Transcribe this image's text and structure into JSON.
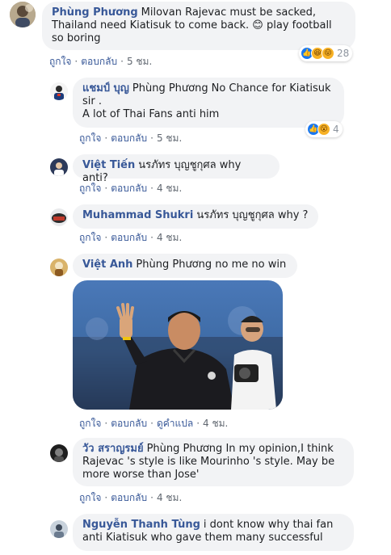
{
  "actions": {
    "like": "ถูกใจ",
    "reply": "ตอบกลับ",
    "see_translation": "ดูคำแปล"
  },
  "comments": [
    {
      "name": "Phùng Phương",
      "text": "Milovan Rajevac must be sacked, Thailand need Kiatisuk to come back. 😊 play football so boring",
      "time": "5 ชม.",
      "reaction_count": "28"
    },
    {
      "name": "แชมป์ บุญ",
      "tag": "Phùng Phương",
      "text_line1": "No Chance for Kiatisuk sir .",
      "text_line2": "A lot of Thai Fans anti him",
      "time": "5 ชม.",
      "reaction_count": "4"
    },
    {
      "name": "Việt Tiến",
      "tag": "นรภัทร บุญชูกุศล",
      "text": "why anti?",
      "time": "4 ชม."
    },
    {
      "name": "Muhammad Shukri",
      "tag": "นรภัทร บุญชูกุศล",
      "text": "why ?",
      "time": "4 ชม."
    },
    {
      "name": "Việt Anh",
      "tag": "Phùng Phương",
      "text": "no me no win",
      "time": "4 ชม."
    },
    {
      "name": "วัว สราญรมย์",
      "tag": "Phùng Phương",
      "text": "In my opinion,I think Rajevac 's style is like Mourinho 's style. May be more worse than Jose'",
      "time": "4 ชม."
    },
    {
      "name": "Nguyễn Thanh Tùng",
      "text": "i dont know why thai fan anti Kiatisuk who gave them many successful"
    }
  ],
  "colors": {
    "link": "#385898",
    "bubble": "#f2f3f5",
    "meta": "#606770"
  }
}
